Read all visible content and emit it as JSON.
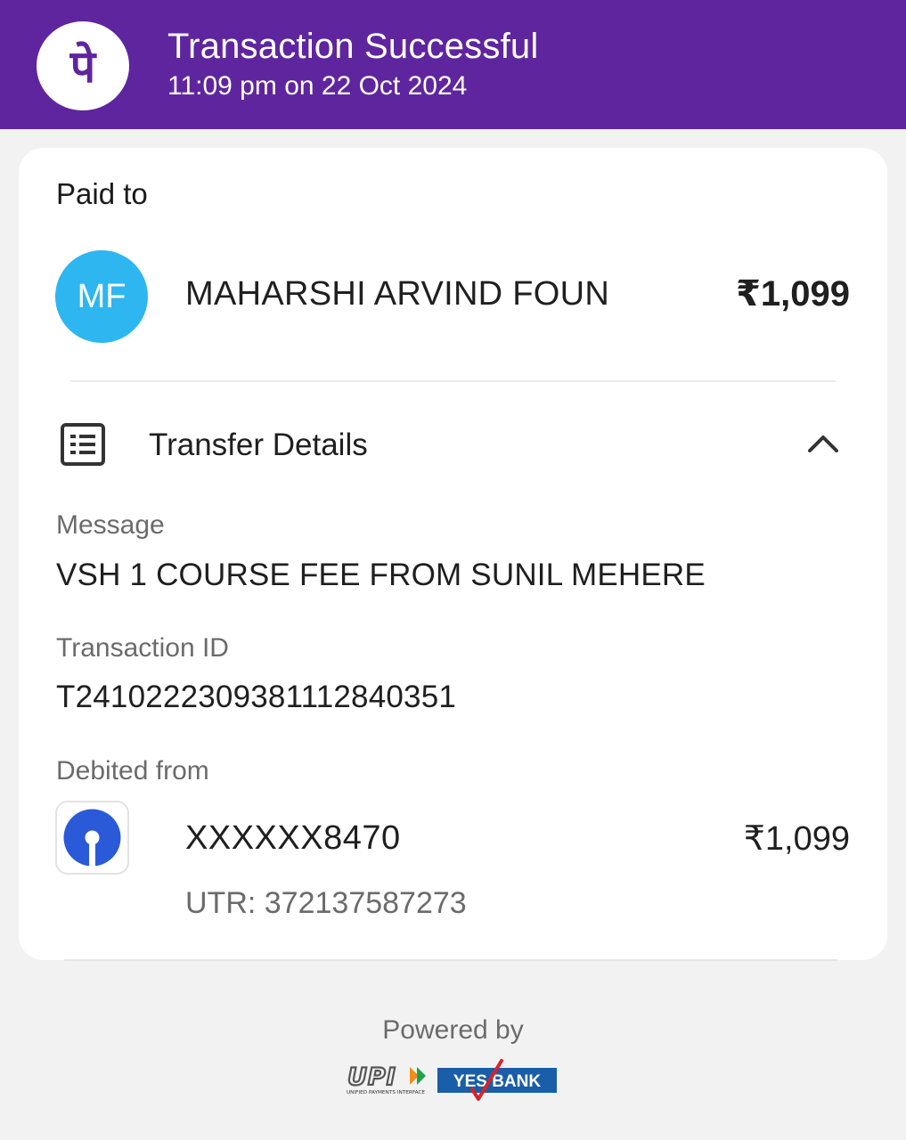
{
  "header": {
    "title": "Transaction Successful",
    "datetime": "11:09 pm on 22 Oct 2024",
    "logo_icon": "phonepe-logo",
    "logo_glyph": "पे",
    "background_color": "#5f259f"
  },
  "paid_to": {
    "section_label": "Paid to",
    "avatar_initials": "MF",
    "avatar_color": "#2eb6f0",
    "name": "MAHARSHI ARVIND FOUN",
    "amount": "₹1,099"
  },
  "transfer_details": {
    "title": "Transfer Details",
    "icon": "receipt-list-icon",
    "expanded": true,
    "message_label": "Message",
    "message_value": "VSH 1 COURSE FEE FROM SUNIL MEHERE",
    "transaction_id_label": "Transaction ID",
    "transaction_id_value": "T2410222309381112840351",
    "debited_from_label": "Debited from",
    "bank_icon": "sbi-bank-logo",
    "account": "XXXXXX8470",
    "amount": "₹1,099",
    "utr": "UTR: 372137587273"
  },
  "footer": {
    "powered_by": "Powered by",
    "upi_logo_text": "UPI",
    "upi_tagline": "UNIFIED PAYMENTS INTERFACE",
    "bank_logo_text": "YES BANK"
  }
}
